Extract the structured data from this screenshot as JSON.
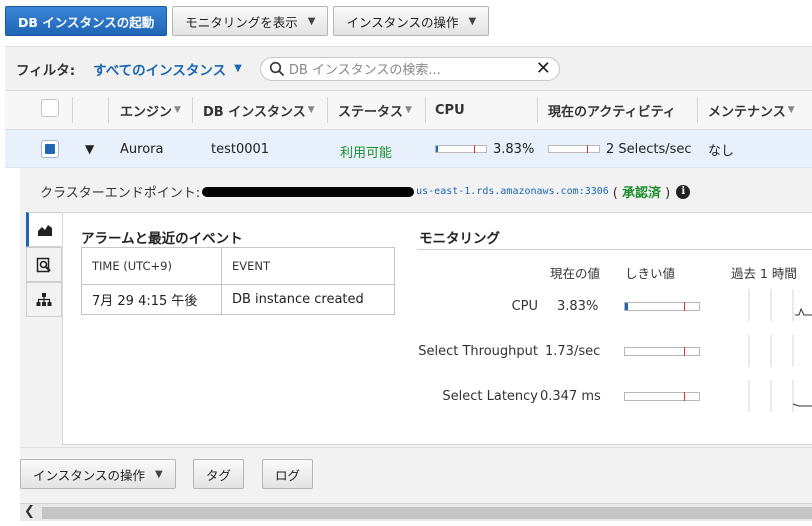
{
  "toolbar": {
    "launch_label": "DB インスタンスの起動",
    "monitoring_label": "モニタリングを表示",
    "instance_actions_label": "インスタンスの操作"
  },
  "filter": {
    "label": "フィルタ:",
    "selected": "すべてのインスタンス",
    "search_placeholder": "DB インスタンスの検索..."
  },
  "table": {
    "headers": {
      "engine": "エンジン",
      "instance": "DB インスタンス",
      "status": "ステータス",
      "cpu": "CPU",
      "activity": "現在のアクティビティ",
      "maintenance": "メンテナンス"
    },
    "rows": [
      {
        "engine": "Aurora",
        "instance": "test0001",
        "status": "利用可能",
        "cpu": "3.83%",
        "cpu_level": 0.0383,
        "activity": "2 Selects/sec",
        "maintenance": "なし"
      }
    ]
  },
  "details": {
    "endpoint_label": "クラスターエンドポイント:",
    "endpoint_host": "us-east-1.rds.amazonaws.com:3306",
    "endpoint_status": "承認済",
    "alarms_title": "アラームと最近のイベント",
    "events_headers": {
      "time": "TIME (UTC+9)",
      "event": "EVENT"
    },
    "events": [
      {
        "time": "7月 29 4:15 午後",
        "event": "DB instance created"
      }
    ],
    "monitoring_title": "モニタリング",
    "monitoring_headers": {
      "current": "現在の値",
      "threshold": "しきい値",
      "history": "過去 1 時間"
    },
    "metrics": [
      {
        "name": "CPU",
        "value": "3.83%",
        "level": 0.0383
      },
      {
        "name": "Select Throughput",
        "value": "1.73/sec",
        "level": 0
      },
      {
        "name": "Select Latency",
        "value": "0.347 ms",
        "level": 0
      }
    ]
  },
  "bottom": {
    "actions_label": "インスタンスの操作",
    "tags_label": "タグ",
    "logs_label": "ログ"
  },
  "icons": {
    "tab1": "area-chart-icon",
    "tab2": "search-document-icon",
    "tab3": "hierarchy-icon"
  },
  "colors": {
    "primary": "#1f66b5",
    "link": "#1a67b2",
    "ok": "#1e8e2c",
    "selected_row": "#e7f0fb"
  }
}
